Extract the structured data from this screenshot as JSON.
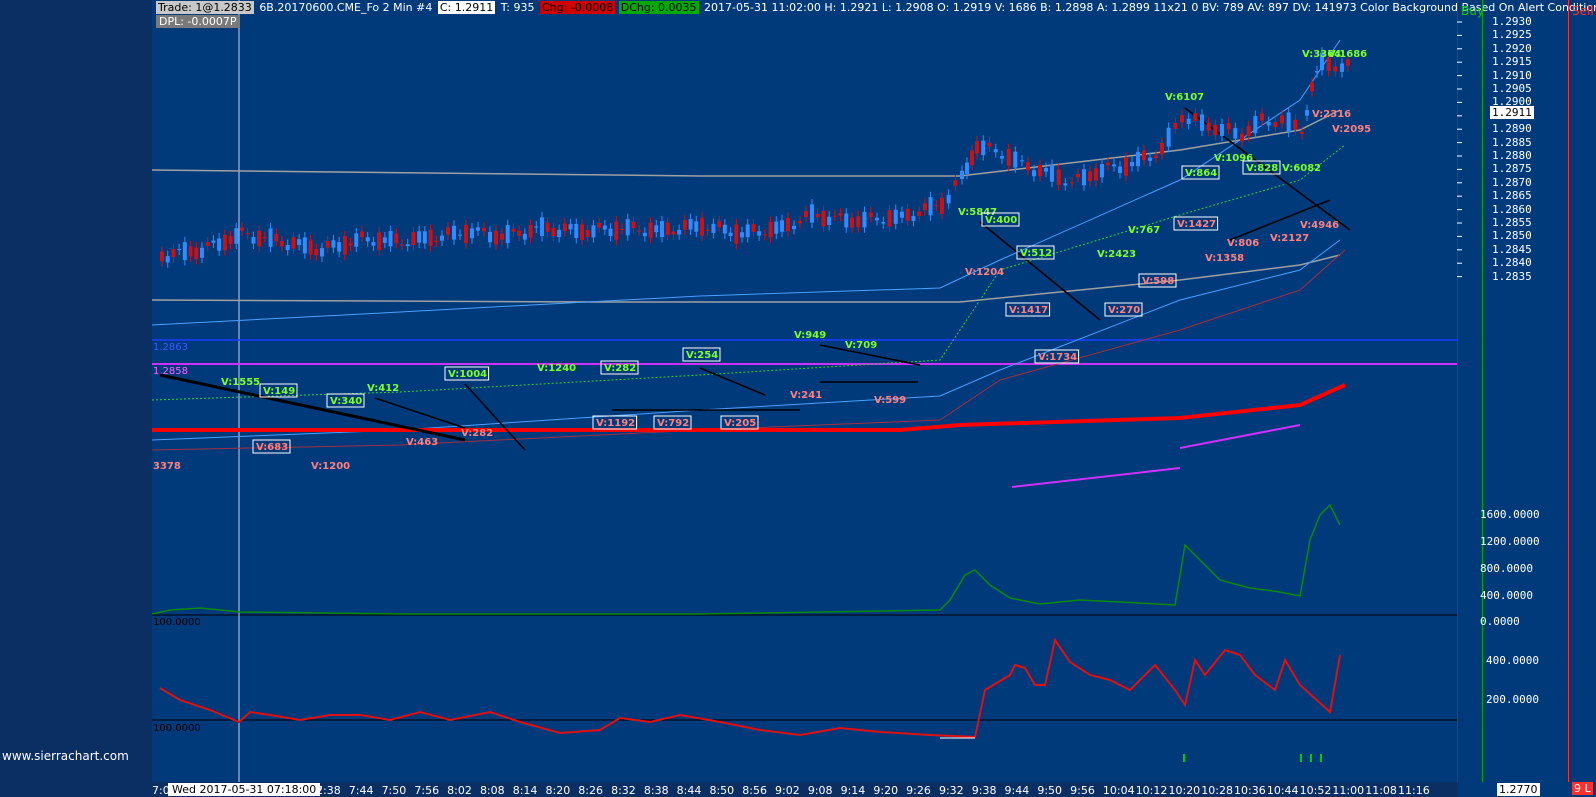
{
  "header": {
    "trade": "Trade: 1@1.2833",
    "symbol": "6B.20170600.CME_Fo  2 Min   #4",
    "close": "C: 1.2911",
    "ticks": "T: 935",
    "chg": "Chg: -0.0008",
    "dchg": "DChg: 0.0035",
    "bar_info": "2017-05-31 11:02:00  H: 1.2921  L: 1.2908  O: 1.2919  V: 1686  B: 1.2898  A: 1.2899  11x21  0  BV: 789  AV: 897  DV: 141973  Color Background Based On Alert Condition  B"
  },
  "dpl": "DPL: -0.0007P",
  "buy_label": "Buy",
  "sell_label": "Sell",
  "current_price": "1.2911",
  "price_axis": [
    "1.2930",
    "1.2925",
    "1.2920",
    "1.2915",
    "1.2910",
    "1.2905",
    "1.2900",
    "1.2895",
    "1.2890",
    "1.2885",
    "1.2880",
    "1.2875",
    "1.2870",
    "1.2865",
    "1.2860",
    "1.2855",
    "1.2850",
    "1.2845",
    "1.2840",
    "1.2835"
  ],
  "panel2_axis": [
    "1600.0000",
    "1200.0000",
    "800.0000",
    "400.0000",
    "0.0000"
  ],
  "panel3_axis": [
    "400.0000",
    "200.0000"
  ],
  "panel2_ref": "100.0000",
  "panel3_ref": "100.0000",
  "level_blue": "1.2863",
  "level_magenta": "1.2858",
  "time_axis": [
    "7:38",
    "7:44",
    "7:50",
    "7:56",
    "8:02",
    "8:08",
    "8:14",
    "8:20",
    "8:26",
    "8:32",
    "8:38",
    "8:44",
    "8:50",
    "8:56",
    "9:02",
    "9:08",
    "9:14",
    "9:20",
    "9:26",
    "9:32",
    "9:38",
    "9:44",
    "9:50",
    "9:56",
    "10:04",
    "10:12",
    "10:20",
    "10:28",
    "10:36",
    "10:44",
    "10:52",
    "11:00",
    "11:08",
    "11:16"
  ],
  "time_axis_partial": [
    "7:0",
    "32"
  ],
  "date_box": "Wed 2017-05-31  07:18:00",
  "bottom_price": "1.2770",
  "bottom_red": "9 L",
  "watermark": "www.sierrachart.com",
  "volume_labels": [
    {
      "t": "V:1555",
      "c": "g"
    },
    {
      "t": "V:149",
      "c": "g"
    },
    {
      "t": "V:340",
      "c": "g"
    },
    {
      "t": "V:412",
      "c": "g"
    },
    {
      "t": "V:1004",
      "c": "g"
    },
    {
      "t": "V:1240",
      "c": "g"
    },
    {
      "t": "V:282",
      "c": "g"
    },
    {
      "t": "V:254",
      "c": "g"
    },
    {
      "t": "V:949",
      "c": "g"
    },
    {
      "t": "V:709",
      "c": "g"
    },
    {
      "t": "V:5847",
      "c": "g"
    },
    {
      "t": "V:400",
      "c": "g"
    },
    {
      "t": "V:512",
      "c": "g"
    },
    {
      "t": "V:2423",
      "c": "g"
    },
    {
      "t": "V:767",
      "c": "g"
    },
    {
      "t": "V:6107",
      "c": "g"
    },
    {
      "t": "V:864",
      "c": "g"
    },
    {
      "t": "V:1096",
      "c": "g"
    },
    {
      "t": "V:828",
      "c": "g"
    },
    {
      "t": "V:6082",
      "c": "g"
    },
    {
      "t": "V:3364",
      "c": "g"
    },
    {
      "t": "V:1686",
      "c": "g"
    },
    {
      "t": "3378",
      "c": "r"
    },
    {
      "t": "V:683",
      "c": "r"
    },
    {
      "t": "V:1200",
      "c": "r"
    },
    {
      "t": "V:463",
      "c": "r"
    },
    {
      "t": "V:282",
      "c": "r"
    },
    {
      "t": "V:1192",
      "c": "r"
    },
    {
      "t": "V:792",
      "c": "r"
    },
    {
      "t": "V:205",
      "c": "r"
    },
    {
      "t": "V:241",
      "c": "r"
    },
    {
      "t": "V:599",
      "c": "r"
    },
    {
      "t": "V:1204",
      "c": "r"
    },
    {
      "t": "V:1417",
      "c": "r"
    },
    {
      "t": "V:1734",
      "c": "r"
    },
    {
      "t": "V:270",
      "c": "r"
    },
    {
      "t": "V:598",
      "c": "r"
    },
    {
      "t": "V:1427",
      "c": "r"
    },
    {
      "t": "V:1358",
      "c": "r"
    },
    {
      "t": "V:806",
      "c": "r"
    },
    {
      "t": "V:2127",
      "c": "r"
    },
    {
      "t": "V:4946",
      "c": "r"
    },
    {
      "t": "V:2316",
      "c": "r"
    },
    {
      "t": "V:2095",
      "c": "r"
    }
  ],
  "colors": {
    "background": "#003a7a",
    "up_candle": "#2f8cff",
    "down_candle": "#d01010",
    "volume_up_text": "#7cff2a",
    "volume_down_text": "#ff8080",
    "level_blue": "#1a3cff",
    "level_magenta": "#d030ff",
    "vwap_red": "#ff0000",
    "osc_green": "#0a8a0a",
    "osc_red": "#e01010"
  }
}
